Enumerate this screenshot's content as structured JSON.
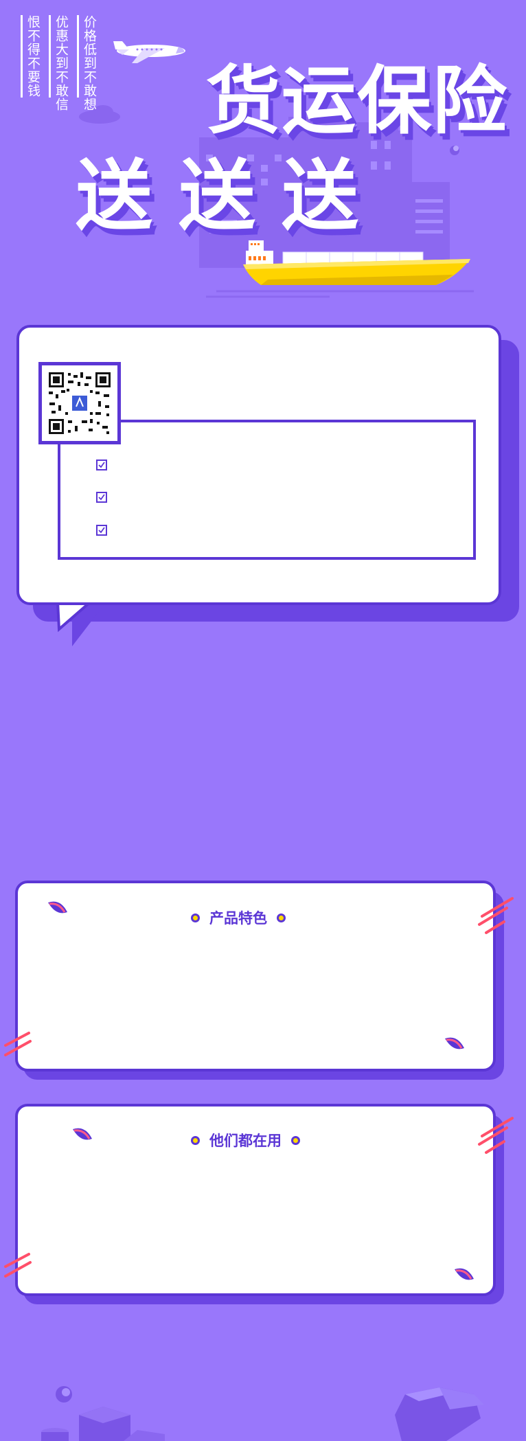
{
  "header": {
    "slogans": [
      "价格低到不敢想",
      "优惠大到不敢信",
      "恨不得不要钱"
    ],
    "title": "货运保险",
    "subtitle": "送送送"
  },
  "sections": [
    {
      "title": "产品特色"
    },
    {
      "title": "他们都在用"
    }
  ],
  "colors": {
    "background": "#9977fb",
    "accent": "#5b36d5",
    "shadow": "#6b45e3",
    "ship_hull": "#ffd400",
    "deco_stripes": "#ff4f6a"
  },
  "icons": {
    "plane": "airplane-icon",
    "ship": "cargo-ship-icon",
    "qr": "qr-code-icon",
    "check": "checkbox-icon",
    "leaf": "leaf-icon"
  }
}
